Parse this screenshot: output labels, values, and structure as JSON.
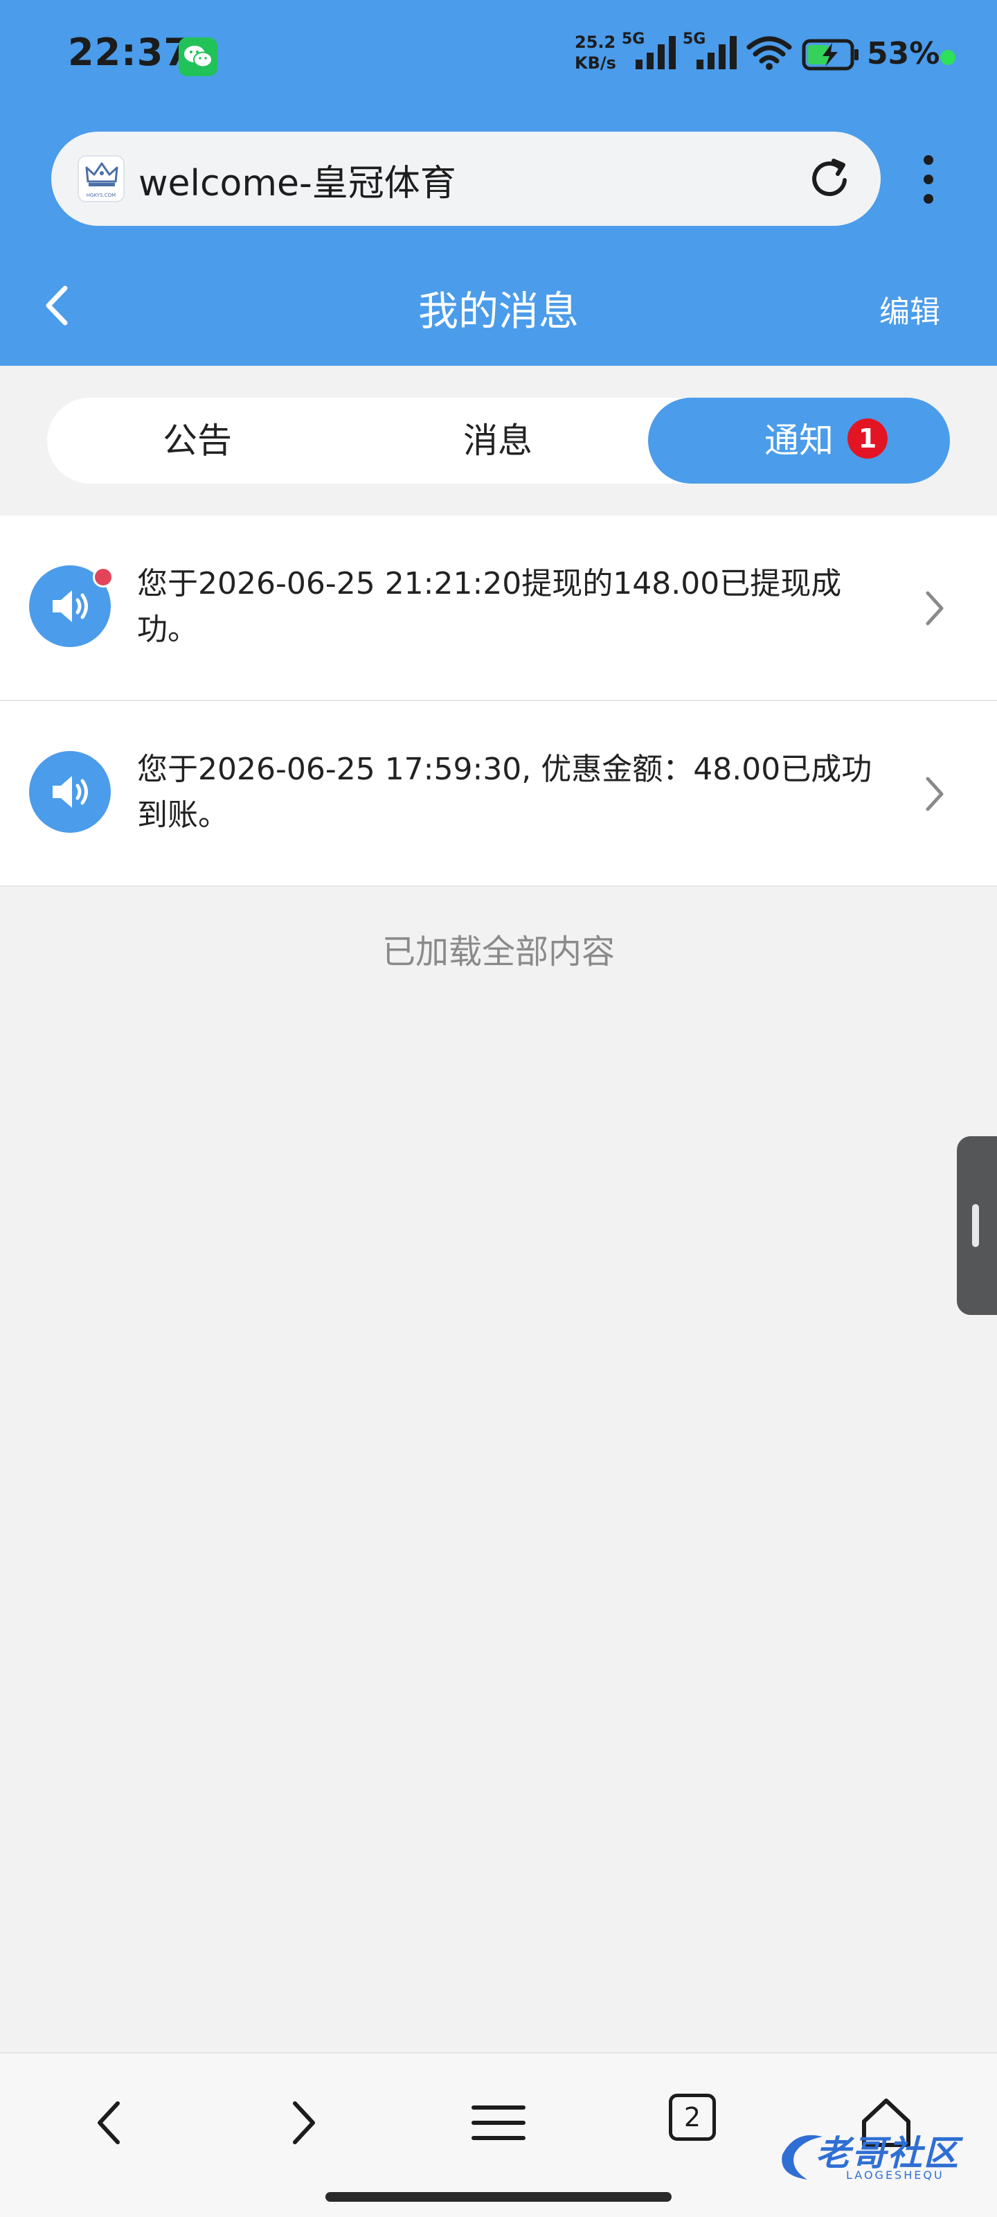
{
  "status_bar": {
    "time": "22:37",
    "net_speed_value": "25.2",
    "net_speed_unit": "KB/s",
    "sim1_type": "5G",
    "sim2_type": "5G",
    "battery": "53%"
  },
  "browser": {
    "url_text": "welcome-皇冠体育",
    "favicon_text": "HGKYS.COM"
  },
  "header": {
    "title": "我的消息",
    "edit_label": "编辑"
  },
  "tabs": [
    {
      "label": "公告",
      "active": false
    },
    {
      "label": "消息",
      "active": false
    },
    {
      "label": "通知",
      "active": true,
      "badge": "1"
    }
  ],
  "messages": [
    {
      "text": "您于2026-06-25 21:21:20提现的148.00已提现成功。",
      "unread": true
    },
    {
      "text": "您于2026-06-25 17:59:30, 优惠金额：48.00已成功到账。",
      "unread": false
    }
  ],
  "list_footer": "已加载全部内容",
  "bottom_nav": {
    "tab_count": "2"
  },
  "watermark": {
    "text": "老哥社区",
    "sub": "LAOGESHEQU"
  },
  "colors": {
    "accent": "#4b9cea",
    "badge": "#e31524",
    "unread_dot": "#e2455a",
    "background": "#f2f2f2"
  }
}
